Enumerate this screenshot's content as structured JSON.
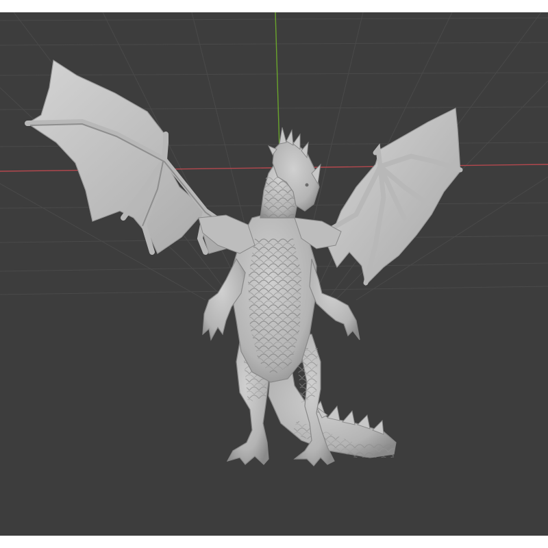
{
  "viewport": {
    "background_color": "#3d3d3d",
    "grid_color": "#4a4a4a",
    "x_axis_color": "#b5484e",
    "y_axis_color": "#6aa52c",
    "object_color": "#c2c2c2",
    "object_shadow_color": "#8e8e8e",
    "object_dark_color": "#6c6c6c"
  }
}
